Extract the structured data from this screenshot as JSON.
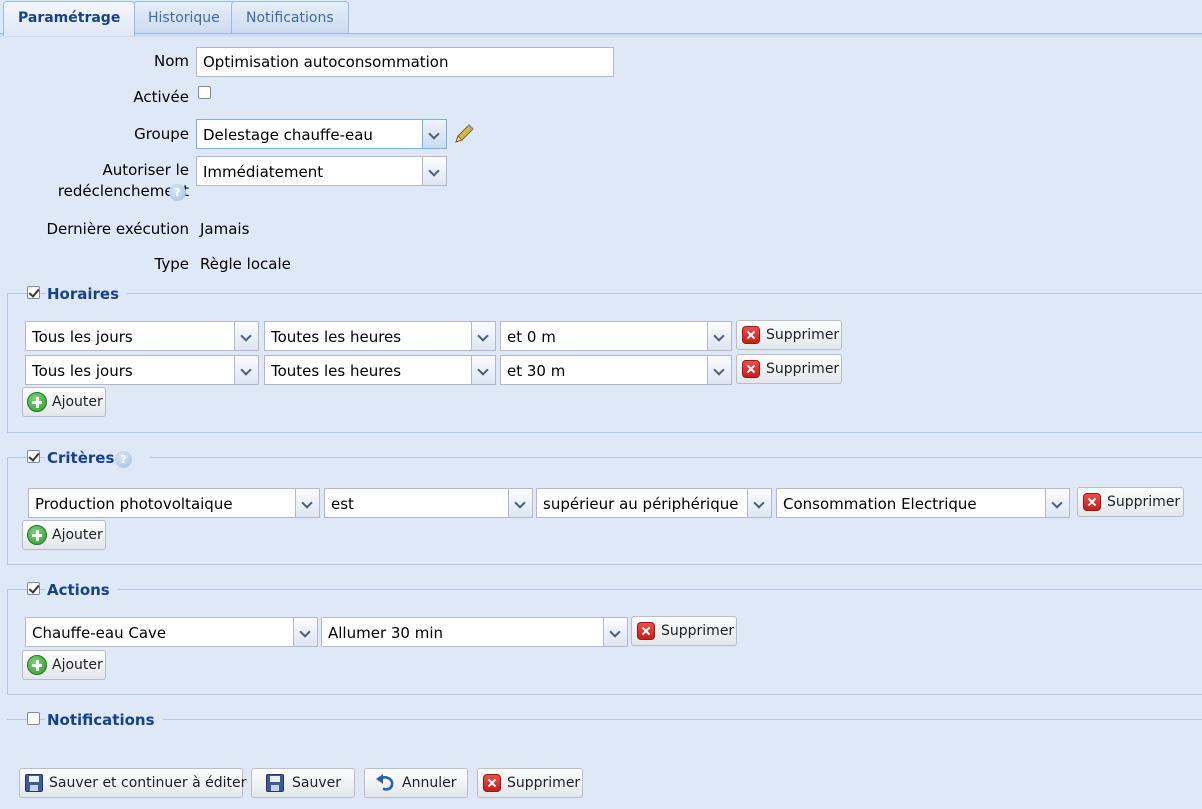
{
  "tabs": [
    {
      "label": "Paramétrage",
      "active": true
    },
    {
      "label": "Historique",
      "active": false
    },
    {
      "label": "Notifications",
      "active": false
    }
  ],
  "form": {
    "nom_label": "Nom",
    "nom_value": "Optimisation autoconsommation",
    "activee_label": "Activée",
    "activee_checked": false,
    "groupe_label": "Groupe",
    "groupe_value": "Delestage chauffe-eau",
    "autoriser_label_line1": "Autoriser le",
    "autoriser_label_line2": "redéclenchement",
    "autoriser_value": "Immédiatement",
    "derniere_label": "Dernière exécution",
    "derniere_value": "Jamais",
    "type_label": "Type",
    "type_value": "Règle locale"
  },
  "horaires": {
    "title": "Horaires",
    "checked": true,
    "rows": [
      {
        "day": "Tous les jours",
        "hour": "Toutes les heures",
        "minute": "et 0 m"
      },
      {
        "day": "Tous les jours",
        "hour": "Toutes les heures",
        "minute": "et 30 m"
      }
    ]
  },
  "criteres": {
    "title": "Critères",
    "checked": true,
    "rows": [
      {
        "source": "Production photovoltaique",
        "verb": "est",
        "comparator": "supérieur au périphérique",
        "target": "Consommation Electrique"
      }
    ]
  },
  "actions": {
    "title": "Actions",
    "checked": true,
    "rows": [
      {
        "device": "Chauffe-eau Cave",
        "command": "Allumer 30 min"
      }
    ]
  },
  "notifications": {
    "title": "Notifications",
    "checked": false
  },
  "labels": {
    "supprimer": "Supprimer",
    "ajouter": "Ajouter"
  },
  "footer": {
    "save_continue": "Sauver et continuer à éditer",
    "save": "Sauver",
    "cancel": "Annuler",
    "delete": "Supprimer"
  },
  "colors": {
    "background": "#dfe8f6",
    "legend_text": "#15428b",
    "border": "#b5c8e6"
  }
}
